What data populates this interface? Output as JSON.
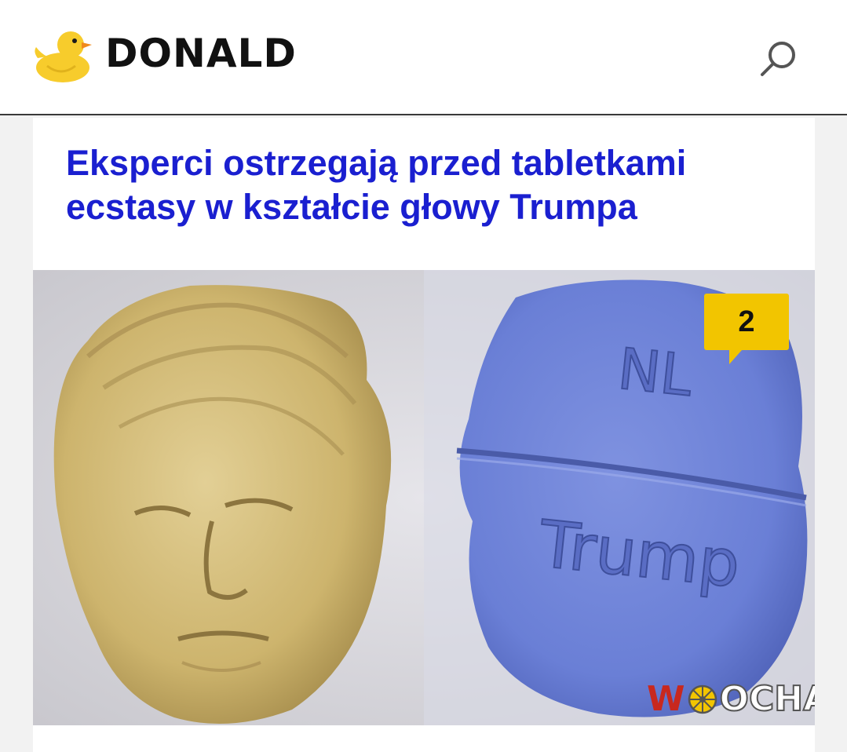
{
  "header": {
    "brand": "DONALD",
    "logo_icon": "duck-icon",
    "search_icon": "search-icon"
  },
  "article": {
    "title": "Eksperci ostrzegają przed tabletkami ecstasy w kształcie głowy Trumpa",
    "image": {
      "left_pill": "yellow pill shaped like a head",
      "right_pill_top_text": "NL",
      "right_pill_bottom_text": "Trump"
    },
    "comments_count": "2",
    "watermark": {
      "first_letter": "W",
      "rest": "OCHA"
    }
  },
  "colors": {
    "title": "#1a1fd0",
    "badge": "#f2c500",
    "watermark_accent": "#c8281e"
  }
}
